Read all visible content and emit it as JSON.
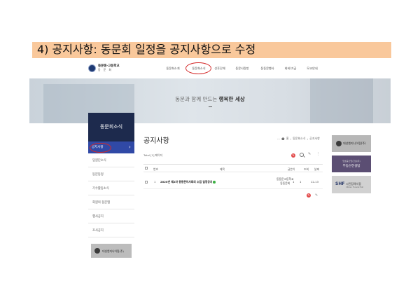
{
  "slide": {
    "title": "4) 공지사항: 동문회 일정을 공지사항으로 수정"
  },
  "site": {
    "logo_line1": "동문중·고등학교",
    "logo_line2": "동 문 회"
  },
  "gnb": [
    {
      "label": "동문회소개"
    },
    {
      "label": "동문회소식"
    },
    {
      "label": "선후단체"
    },
    {
      "label": "동문사랑방"
    },
    {
      "label": "동동문행사"
    },
    {
      "label": "회비/기금"
    },
    {
      "label": "모교안내"
    }
  ],
  "banner": {
    "prefix": "동문과 함께 만드는 ",
    "emphasis": "행복한 세상"
  },
  "lnb": {
    "title": "동문회소식",
    "active_item": "공지사항",
    "items": [
      "임원단소식",
      "동문동정",
      "기수활동소식",
      "회원의 동문앱",
      "행사공지",
      "조사공지"
    ],
    "ad_text": "대성엔지니어링(주)"
  },
  "board": {
    "title": "공지사항",
    "breadcrumb": [
      "홈",
      "동문회소식",
      "공지사항"
    ],
    "breadcrumb_more": "···",
    "total": "Total [1] 페이지",
    "columns": [
      "번호",
      "제목",
      "글쓴이",
      "조회",
      "날짜"
    ],
    "rows": [
      {
        "no": "1",
        "subject": "2020년 제2차 동동문이사회의 소집 일정공지",
        "author_line1": "동동문고등학교",
        "author_line2": "동동문회",
        "files": "1",
        "views": "1",
        "date": "12-13"
      }
    ]
  },
  "ads": {
    "ad1": "대성엔지니어링(주)",
    "ad2_sub": "임호중산업/건설(주)",
    "ad2_main": "부동산전설탐",
    "ad3_logo": "SHF",
    "ad3_text": "시민장례식장",
    "ad3_sub": "Citizen Funeral Hall"
  },
  "colors": {
    "accent_red": "#d42a2a",
    "lnb_head": "#1d2a4d",
    "lnb_active": "#3049a6",
    "title_bar": "#f9c89b"
  },
  "icons": [
    "home-icon",
    "write-icon",
    "search-icon",
    "edit-icon",
    "more-icon",
    "arrow-right-icon"
  ]
}
